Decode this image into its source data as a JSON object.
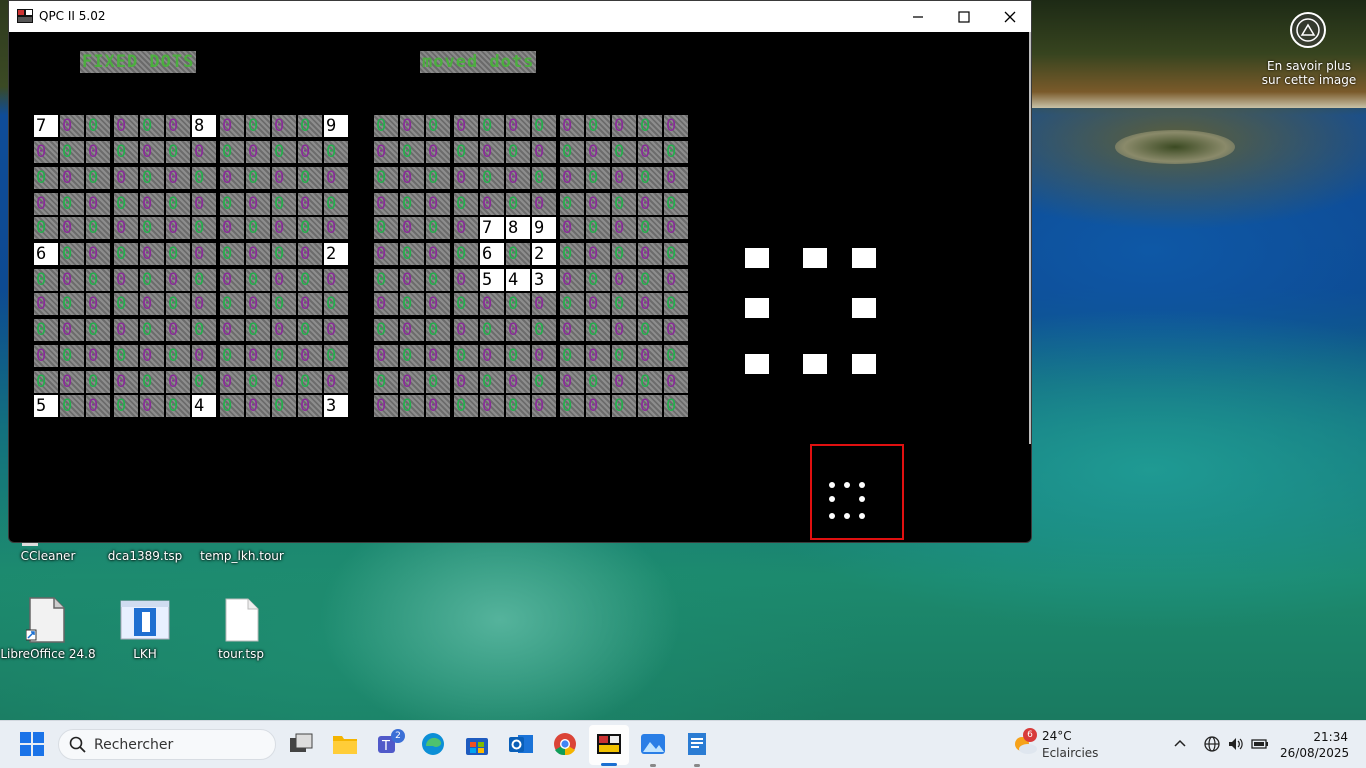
{
  "window": {
    "title": "QPC II 5.02"
  },
  "headers": {
    "fixed": "FIXED DOTS",
    "moved": "moved dots"
  },
  "fixed_grid": [
    [
      "7",
      "0",
      "0",
      "0",
      "0",
      "0",
      "8",
      "0",
      "0",
      "0",
      "0",
      "9"
    ],
    [
      "0",
      "0",
      "0",
      "0",
      "0",
      "0",
      "0",
      "0",
      "0",
      "0",
      "0",
      "0"
    ],
    [
      "0",
      "0",
      "0",
      "0",
      "0",
      "0",
      "0",
      "0",
      "0",
      "0",
      "0",
      "0"
    ],
    [
      "0",
      "0",
      "0",
      "0",
      "0",
      "0",
      "0",
      "0",
      "0",
      "0",
      "0",
      "0"
    ],
    [
      "0",
      "0",
      "0",
      "0",
      "0",
      "0",
      "0",
      "0",
      "0",
      "0",
      "0",
      "0"
    ],
    [
      "6",
      "0",
      "0",
      "0",
      "0",
      "0",
      "0",
      "0",
      "0",
      "0",
      "0",
      "2"
    ],
    [
      "0",
      "0",
      "0",
      "0",
      "0",
      "0",
      "0",
      "0",
      "0",
      "0",
      "0",
      "0"
    ],
    [
      "0",
      "0",
      "0",
      "0",
      "0",
      "0",
      "0",
      "0",
      "0",
      "0",
      "0",
      "0"
    ],
    [
      "0",
      "0",
      "0",
      "0",
      "0",
      "0",
      "0",
      "0",
      "0",
      "0",
      "0",
      "0"
    ],
    [
      "0",
      "0",
      "0",
      "0",
      "0",
      "0",
      "0",
      "0",
      "0",
      "0",
      "0",
      "0"
    ],
    [
      "0",
      "0",
      "0",
      "0",
      "0",
      "0",
      "0",
      "0",
      "0",
      "0",
      "0",
      "0"
    ],
    [
      "5",
      "0",
      "0",
      "0",
      "0",
      "0",
      "4",
      "0",
      "0",
      "0",
      "0",
      "3"
    ]
  ],
  "moved_grid": [
    [
      "0",
      "0",
      "0",
      "0",
      "0",
      "0",
      "0",
      "0",
      "0",
      "0",
      "0",
      "0"
    ],
    [
      "0",
      "0",
      "0",
      "0",
      "0",
      "0",
      "0",
      "0",
      "0",
      "0",
      "0",
      "0"
    ],
    [
      "0",
      "0",
      "0",
      "0",
      "0",
      "0",
      "0",
      "0",
      "0",
      "0",
      "0",
      "0"
    ],
    [
      "0",
      "0",
      "0",
      "0",
      "0",
      "0",
      "0",
      "0",
      "0",
      "0",
      "0",
      "0"
    ],
    [
      "0",
      "0",
      "0",
      "0",
      "7",
      "8",
      "9",
      "0",
      "0",
      "0",
      "0",
      "0"
    ],
    [
      "0",
      "0",
      "0",
      "0",
      "6",
      "0",
      "2",
      "0",
      "0",
      "0",
      "0",
      "0"
    ],
    [
      "0",
      "0",
      "0",
      "0",
      "5",
      "4",
      "3",
      "0",
      "0",
      "0",
      "0",
      "0"
    ],
    [
      "0",
      "0",
      "0",
      "0",
      "0",
      "0",
      "0",
      "0",
      "0",
      "0",
      "0",
      "0"
    ],
    [
      "0",
      "0",
      "0",
      "0",
      "0",
      "0",
      "0",
      "0",
      "0",
      "0",
      "0",
      "0"
    ],
    [
      "0",
      "0",
      "0",
      "0",
      "0",
      "0",
      "0",
      "0",
      "0",
      "0",
      "0",
      "0"
    ],
    [
      "0",
      "0",
      "0",
      "0",
      "0",
      "0",
      "0",
      "0",
      "0",
      "0",
      "0",
      "0"
    ],
    [
      "0",
      "0",
      "0",
      "0",
      "0",
      "0",
      "0",
      "0",
      "0",
      "0",
      "0",
      "0"
    ]
  ],
  "colors": {
    "zero_green": "#22b14c",
    "zero_magenta": "#8a2a9a",
    "highlight": "#ffffff",
    "preview_border": "#e01010"
  },
  "desktop": {
    "learn_more": "En savoir plus sur cette image",
    "icons_row1": [
      "CCleaner",
      "dca1389.tsp",
      "temp_lkh.tour"
    ],
    "icons_row2": [
      "LibreOffice 24.8",
      "LKH",
      "tour.tsp"
    ]
  },
  "taskbar": {
    "search_placeholder": "Rechercher",
    "teams_badge": "2",
    "weather_badge": "6",
    "weather_temp": "24°C",
    "weather_desc": "Eclaircies",
    "time": "21:34",
    "date": "26/08/2025",
    "icons": [
      "task-view-icon",
      "file-explorer-icon",
      "teams-icon",
      "edge-icon",
      "store-icon",
      "outlook-icon",
      "chrome-icon",
      "qpc-icon",
      "photos-icon",
      "word-icon"
    ]
  }
}
